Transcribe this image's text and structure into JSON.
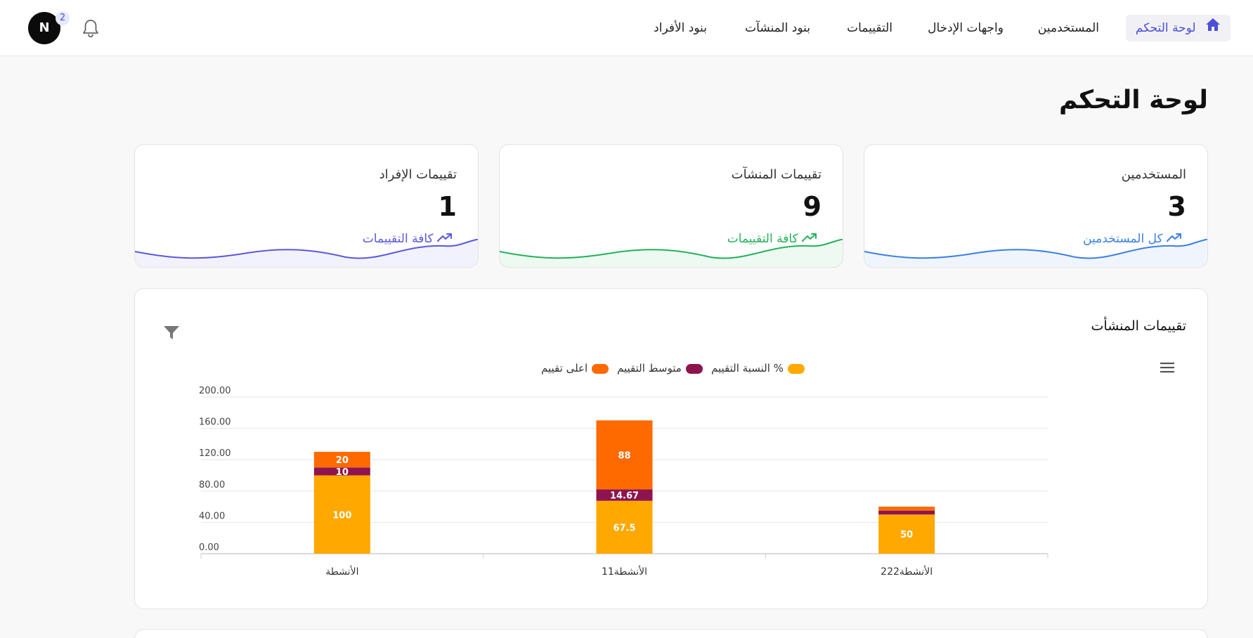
{
  "nav": {
    "items": [
      {
        "label": "لوحة التحكم",
        "active": true
      },
      {
        "label": "المستخدمين"
      },
      {
        "label": "واجهات الإدخال"
      },
      {
        "label": "التقييمات"
      },
      {
        "label": "بنود المنشآت"
      },
      {
        "label": "بنود الأفراد"
      }
    ],
    "avatar_initial": "N",
    "notification_count": "2"
  },
  "page_title": "لوحة التحكم",
  "stats": [
    {
      "label": "المستخدمين",
      "value": "3",
      "link": "كل المستخدمين",
      "color": "#3b7fe8"
    },
    {
      "label": "تقييمات المنشآت",
      "value": "9",
      "link": "كافة التقييمات",
      "color": "#22b35a"
    },
    {
      "label": "تقييمات الإفراد",
      "value": "1",
      "link": "كافة التقييمات",
      "color": "#5a57e0"
    }
  ],
  "chart_card": {
    "title": "تقييمات المنشأت"
  },
  "chart_data": {
    "type": "bar",
    "stacked": true,
    "categories": [
      "الأنشطة",
      "الأنشطة11",
      "الأنشطة222"
    ],
    "series": [
      {
        "name": "النسبة التقييم %",
        "color": "#ffa800",
        "values": [
          100,
          67.5,
          50
        ]
      },
      {
        "name": "متوسط التقييم",
        "color": "#8e1450",
        "values": [
          10,
          14.67,
          5
        ]
      },
      {
        "name": "اعلى تقييم",
        "color": "#ff6a00",
        "values": [
          20,
          88,
          5
        ]
      }
    ],
    "data_labels": [
      [
        "100",
        "67.5",
        "50"
      ],
      [
        "10",
        "14.67",
        ""
      ],
      [
        "20",
        "88",
        ""
      ]
    ],
    "y_ticks": [
      "0.00",
      "40.00",
      "80.00",
      "120.00",
      "160.00",
      "200.00"
    ],
    "ylim": [
      0,
      200
    ],
    "grid": true,
    "legend_position": "top"
  }
}
